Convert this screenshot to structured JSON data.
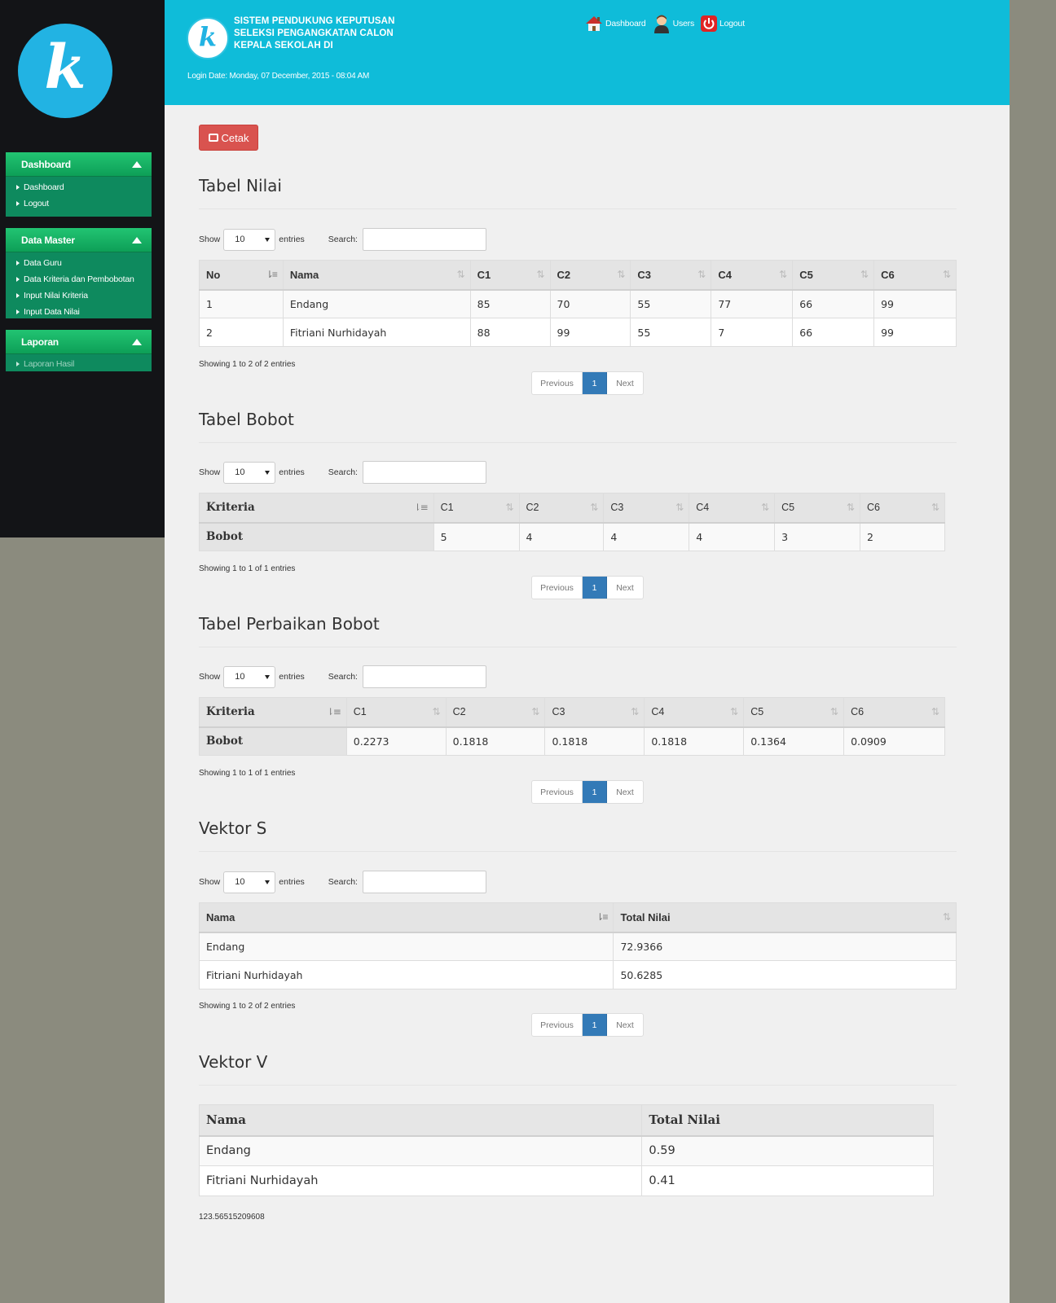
{
  "sidebar": {
    "logo_letter": "k",
    "panels": [
      {
        "title": "Dashboard",
        "items": [
          {
            "label": "Dashboard"
          },
          {
            "label": "Logout"
          }
        ]
      },
      {
        "title": "Data Master",
        "items": [
          {
            "label": "Data Guru"
          },
          {
            "label": "Data Kriteria dan Pembobotan"
          },
          {
            "label": "Input Nilai Kriteria"
          },
          {
            "label": "Input Data Nilai"
          }
        ]
      },
      {
        "title": "Laporan",
        "items": [
          {
            "label": "Laporan Hasil"
          }
        ]
      }
    ]
  },
  "header": {
    "logo_letter": "k",
    "title_lines": [
      "SISTEM PENDUKUNG KEPUTUSAN",
      "SELEKSI PENGANGKATAN CALON",
      "KEPALA SEKOLAH DI"
    ],
    "login_date": "Login Date: Monday, 07 December, 2015 - 08:04 AM",
    "nav": [
      {
        "label": "Dashboard",
        "icon": "home-icon"
      },
      {
        "label": "Users",
        "icon": "user-icon"
      },
      {
        "label": "Logout",
        "icon": "power-icon"
      }
    ]
  },
  "actions": {
    "print_label": "Cetak"
  },
  "common": {
    "show_label": "Show",
    "entries_label": "entries",
    "search_label": "Search:",
    "page_length": "10",
    "prev_label": "Previous",
    "page_number": "1",
    "next_label": "Next"
  },
  "tabel_nilai": {
    "title": "Tabel Nilai",
    "columns": [
      "No",
      "Nama",
      "C1",
      "C2",
      "C3",
      "C4",
      "C5",
      "C6"
    ],
    "rows": [
      [
        "1",
        "Endang",
        "85",
        "70",
        "55",
        "77",
        "66",
        "99"
      ],
      [
        "2",
        "Fitriani Nurhidayah",
        "88",
        "99",
        "55",
        "7",
        "66",
        "99"
      ]
    ],
    "info": "Showing 1 to 2 of 2 entries"
  },
  "tabel_bobot": {
    "title": "Tabel Bobot",
    "columns": [
      "Kriteria",
      "C1",
      "C2",
      "C3",
      "C4",
      "C5",
      "C6"
    ],
    "row_label": "Bobot",
    "values": [
      "5",
      "4",
      "4",
      "4",
      "3",
      "2"
    ],
    "info": "Showing 1 to 1 of 1 entries"
  },
  "tabel_perbaikan": {
    "title": "Tabel Perbaikan Bobot",
    "columns": [
      "Kriteria",
      "C1",
      "C2",
      "C3",
      "C4",
      "C5",
      "C6"
    ],
    "row_label": "Bobot",
    "values": [
      "0.2273",
      "0.1818",
      "0.1818",
      "0.1818",
      "0.1364",
      "0.0909"
    ],
    "info": "Showing 1 to 1 of 1 entries"
  },
  "vektor_s": {
    "title": "Vektor S",
    "columns": [
      "Nama",
      "Total Nilai"
    ],
    "rows": [
      [
        "Endang",
        "72.9366"
      ],
      [
        "Fitriani Nurhidayah",
        "50.6285"
      ]
    ],
    "info": "Showing 1 to 2 of 2 entries"
  },
  "vektor_v": {
    "title": "Vektor V",
    "columns": [
      "Nama",
      "Total Nilai"
    ],
    "rows": [
      [
        "Endang",
        "0.59"
      ],
      [
        "Fitriani Nurhidayah",
        "0.41"
      ]
    ]
  },
  "footer_value": "123.56515209608",
  "colors": {
    "header": "#0fbcd9",
    "sidebar": "#131417",
    "panel": "#0e8a5e",
    "print_button": "#d9534f",
    "active_page": "#337ab7"
  }
}
